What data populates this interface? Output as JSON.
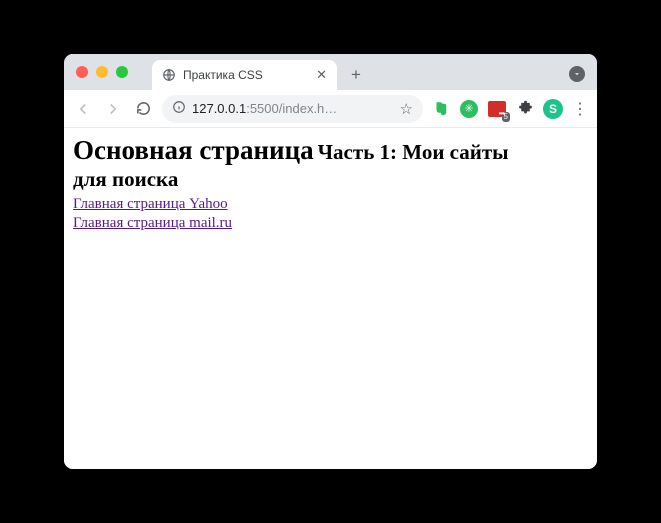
{
  "browser": {
    "tab": {
      "title": "Практика CSS"
    },
    "omnibox": {
      "host_prefix": "127.0.0.1",
      "port_path": ":5500/index.h…"
    },
    "extensions": {
      "lastpass_badge": "5",
      "s_letter": "S"
    }
  },
  "page": {
    "heading_main": "Основная страница",
    "heading_sub_part": "Часть 1: Мои сайты",
    "heading_sub_line2": "для поиска",
    "links": {
      "yahoo": "Главная страница Yahoo",
      "mailru": "Главная страница mail.ru"
    }
  }
}
